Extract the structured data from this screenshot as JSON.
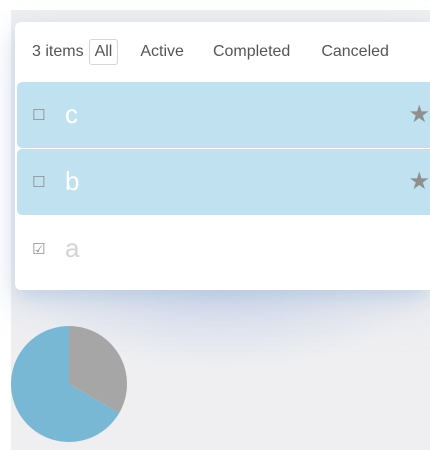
{
  "filters": {
    "count_label": "3 items",
    "options": [
      "All",
      "Active",
      "Completed",
      "Canceled"
    ],
    "selected": "All"
  },
  "todos": [
    {
      "text": "c",
      "checkbox": "☐",
      "starred": true,
      "star": "★",
      "completed": false
    },
    {
      "text": "b",
      "checkbox": "☐",
      "starred": true,
      "star": "★",
      "completed": false
    },
    {
      "text": "a",
      "checkbox": "☑",
      "starred": false,
      "completed": true
    }
  ],
  "colors": {
    "starred_row": "#bfe1f0",
    "pie_primary": "#79b8d4",
    "pie_secondary": "#a6a6a6"
  },
  "pie": {
    "slices": [
      {
        "icon": "pie-slice-blue",
        "value": 2
      },
      {
        "icon": "pie-slice-gray",
        "value": 1
      }
    ]
  }
}
